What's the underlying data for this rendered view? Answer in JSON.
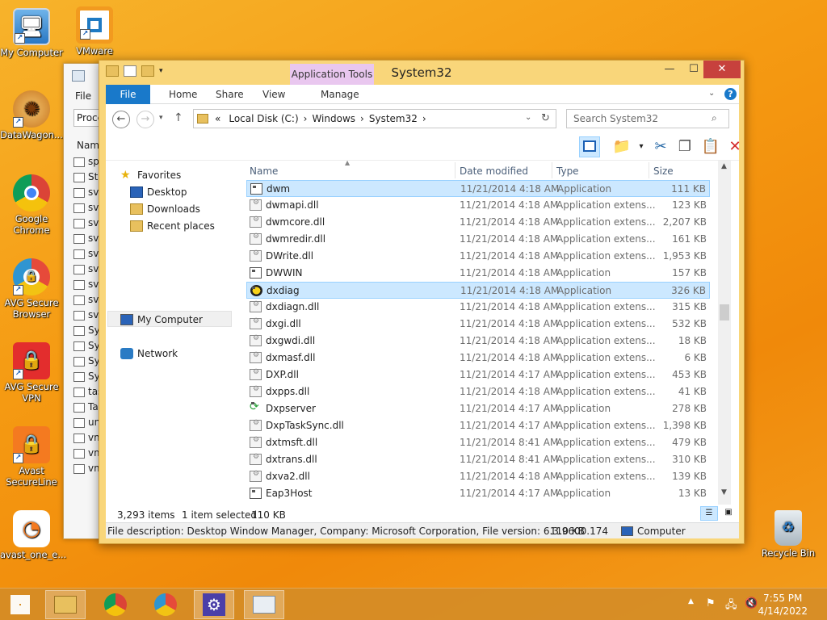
{
  "desktop": {
    "icons": [
      {
        "label": "My Computer"
      },
      {
        "label": "VMware"
      },
      {
        "label": "DataWagon..."
      },
      {
        "label": "Google Chrome"
      },
      {
        "label": "AVG Secure Browser"
      },
      {
        "label": "AVG Secure VPN"
      },
      {
        "label": "Avast SecureLine"
      },
      {
        "label": "avast_one_e..."
      },
      {
        "label": "Recycle Bin"
      }
    ]
  },
  "back_window": {
    "menu": "File",
    "tab": "Proce",
    "col": "Nam",
    "items": [
      "sp",
      "Sta",
      "svc",
      "svc",
      "svc",
      "svc",
      "svc",
      "svc",
      "svc",
      "svc",
      "svc",
      "Sy",
      "Sy",
      "Sy",
      "Sy",
      "tas",
      "Ta",
      "un",
      "vm",
      "vm",
      "vm"
    ]
  },
  "window": {
    "title": "System32",
    "context_tab": "Application Tools",
    "tabs": {
      "file": "File",
      "home": "Home",
      "share": "Share",
      "view": "View",
      "manage": "Manage"
    },
    "address": {
      "prefix": "«",
      "seg1": "Local Disk (C:)",
      "seg2": "Windows",
      "seg3": "System32"
    },
    "search_placeholder": "Search System32",
    "nav": {
      "favorites": "Favorites",
      "desktop": "Desktop",
      "downloads": "Downloads",
      "recent": "Recent places",
      "mycomputer": "My Computer",
      "network": "Network"
    },
    "columns": {
      "name": "Name",
      "date": "Date modified",
      "type": "Type",
      "size": "Size"
    },
    "files": [
      {
        "name": "dwm",
        "date": "11/21/2014 4:18 AM",
        "type": "Application",
        "size": "111 KB",
        "kind": "app"
      },
      {
        "name": "dwmapi.dll",
        "date": "11/21/2014 4:18 AM",
        "type": "Application extens...",
        "size": "123 KB",
        "kind": "dll"
      },
      {
        "name": "dwmcore.dll",
        "date": "11/21/2014 4:18 AM",
        "type": "Application extens...",
        "size": "2,207 KB",
        "kind": "dll"
      },
      {
        "name": "dwmredir.dll",
        "date": "11/21/2014 4:18 AM",
        "type": "Application extens...",
        "size": "161 KB",
        "kind": "dll"
      },
      {
        "name": "DWrite.dll",
        "date": "11/21/2014 4:18 AM",
        "type": "Application extens...",
        "size": "1,953 KB",
        "kind": "dll"
      },
      {
        "name": "DWWIN",
        "date": "11/21/2014 4:18 AM",
        "type": "Application",
        "size": "157 KB",
        "kind": "app"
      },
      {
        "name": "dxdiag",
        "date": "11/21/2014 4:18 AM",
        "type": "Application",
        "size": "326 KB",
        "kind": "dx"
      },
      {
        "name": "dxdiagn.dll",
        "date": "11/21/2014 4:18 AM",
        "type": "Application extens...",
        "size": "315 KB",
        "kind": "dll"
      },
      {
        "name": "dxgi.dll",
        "date": "11/21/2014 4:18 AM",
        "type": "Application extens...",
        "size": "532 KB",
        "kind": "dll"
      },
      {
        "name": "dxgwdi.dll",
        "date": "11/21/2014 4:18 AM",
        "type": "Application extens...",
        "size": "18 KB",
        "kind": "dll"
      },
      {
        "name": "dxmasf.dll",
        "date": "11/21/2014 4:18 AM",
        "type": "Application extens...",
        "size": "6 KB",
        "kind": "dll"
      },
      {
        "name": "DXP.dll",
        "date": "11/21/2014 4:17 AM",
        "type": "Application extens...",
        "size": "453 KB",
        "kind": "dll"
      },
      {
        "name": "dxpps.dll",
        "date": "11/21/2014 4:18 AM",
        "type": "Application extens...",
        "size": "41 KB",
        "kind": "dll"
      },
      {
        "name": "Dxpserver",
        "date": "11/21/2014 4:17 AM",
        "type": "Application",
        "size": "278 KB",
        "kind": "sync"
      },
      {
        "name": "DxpTaskSync.dll",
        "date": "11/21/2014 4:17 AM",
        "type": "Application extens...",
        "size": "1,398 KB",
        "kind": "dll"
      },
      {
        "name": "dxtmsft.dll",
        "date": "11/21/2014 8:41 AM",
        "type": "Application extens...",
        "size": "479 KB",
        "kind": "dll"
      },
      {
        "name": "dxtrans.dll",
        "date": "11/21/2014 8:41 AM",
        "type": "Application extens...",
        "size": "310 KB",
        "kind": "dll"
      },
      {
        "name": "dxva2.dll",
        "date": "11/21/2014 4:18 AM",
        "type": "Application extens...",
        "size": "139 KB",
        "kind": "dll"
      },
      {
        "name": "Eap3Host",
        "date": "11/21/2014 4:17 AM",
        "type": "Application",
        "size": "13 KB",
        "kind": "app"
      }
    ],
    "status": {
      "count": "3,293 items",
      "selected": "1 item selected",
      "size": "110 KB"
    },
    "details": {
      "description": "File description: Desktop Window Manager, Company: Microsoft Corporation, File version: 6.3.9600.174",
      "size": "110 KB",
      "location": "Computer"
    }
  },
  "taskbar": {
    "time": "7:55 PM",
    "date": "4/14/2022"
  },
  "colors": {
    "accent": "#1979ca",
    "selection": "#cce8ff",
    "desktop": "#f59a12"
  }
}
